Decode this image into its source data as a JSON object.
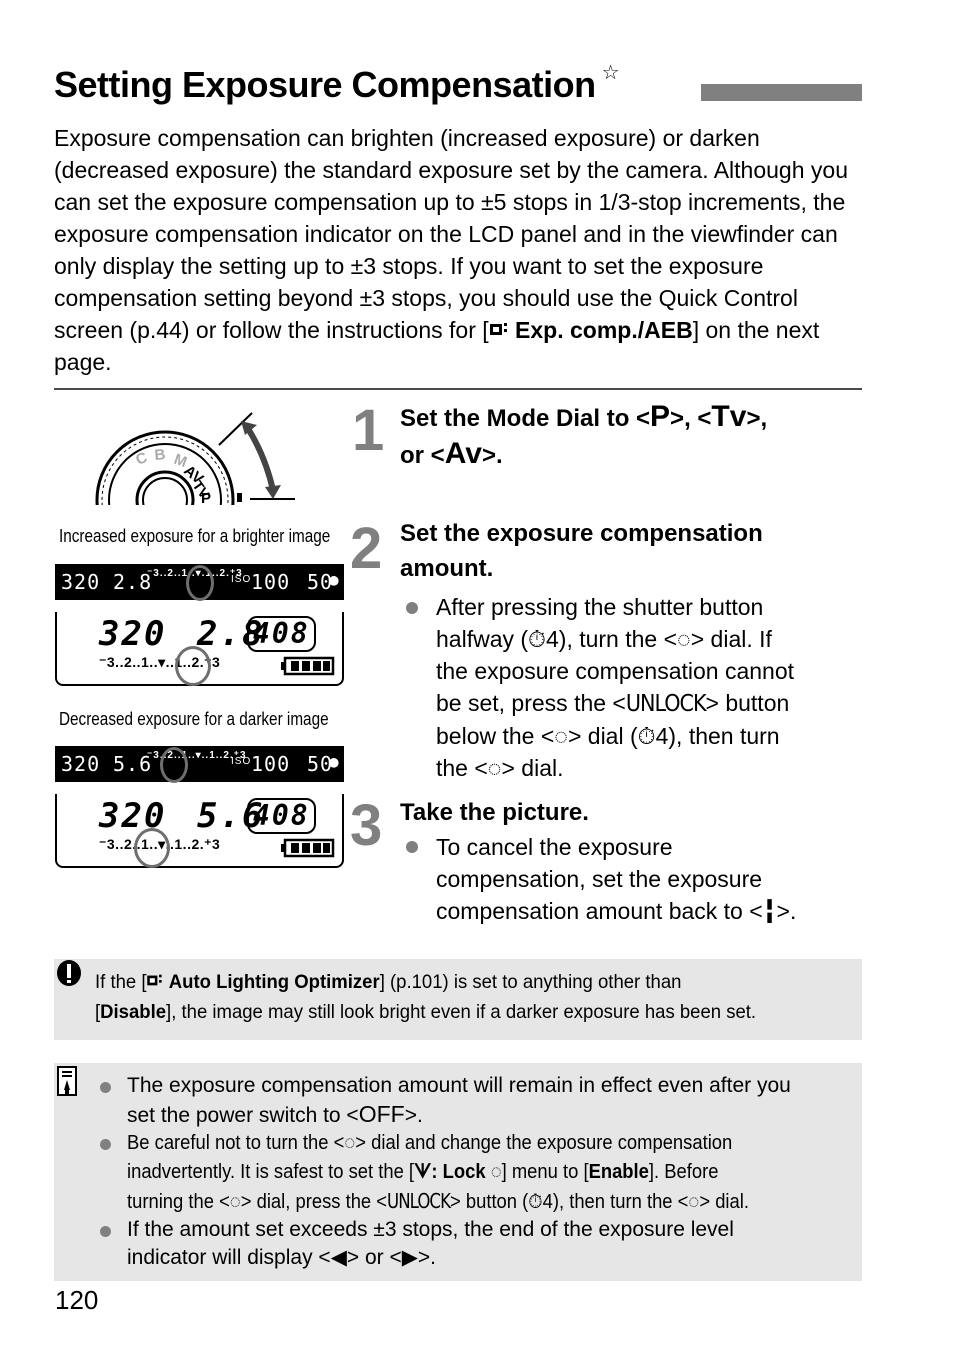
{
  "header": {
    "title": "Setting Exposure Compensation",
    "title_mark": "☆"
  },
  "intro": {
    "text_before": "Exposure compensation can brighten (increased exposure) or darken (decreased exposure) the standard exposure set by the camera. Although you can set the exposure compensation up to ±5 stops in 1/3-stop increments, the exposure compensation indicator on the LCD panel and in the viewfinder can only display the setting up to ±3 stops. If you want to set the exposure compensation setting beyond ±3 stops, you should use the Quick Control screen (p.44) or follow the instructions for [",
    "menu_icon": "camera-menu-icon",
    "menu_label": "Exp. comp./AEB",
    "text_after": "] on the next page."
  },
  "figures": {
    "mode_dial": {
      "labels": [
        "AV",
        "TV",
        "P",
        "M",
        "B",
        "C"
      ]
    },
    "increased": {
      "caption": "Increased exposure for a brighter image",
      "viewfinder": {
        "shutter": "320",
        "aperture": "2.8",
        "scale": "⁻3..2..1..▾.1..2.⁺3",
        "iso_label": "ISO",
        "iso": "100",
        "shots": "50"
      },
      "lcd": {
        "shutter": "320",
        "aperture": "2.8",
        "shots": "408",
        "scale": "⁻3..2..1..▾..1..2.⁺3",
        "compensation_stops": 1
      }
    },
    "decreased": {
      "caption": "Decreased exposure for a darker image",
      "viewfinder": {
        "shutter": "320",
        "aperture": "5.6",
        "scale": "⁻3..2..1..▾..1..2.⁺3",
        "iso_label": "ISO",
        "iso": "100",
        "shots": "50"
      },
      "lcd": {
        "shutter": "320",
        "aperture": "5.6",
        "shots": "408",
        "scale": "⁻3..2..1..▾..1..2.⁺3",
        "compensation_stops": -1
      }
    }
  },
  "steps": [
    {
      "number": "1",
      "title_parts": [
        "Set the Mode Dial to <",
        "P",
        ">, <",
        "Tv",
        ">,",
        "or <",
        "Av",
        ">."
      ]
    },
    {
      "number": "2",
      "title": "Set the exposure compensation amount.",
      "bullet": {
        "line1": "After pressing the shutter button",
        "line2a": "halfway (",
        "timer": "⏱4",
        "line2b": "), turn the <",
        "line2c": "> dial. If",
        "line3": "the exposure compensation cannot",
        "line4a": "be set, press the <",
        "unlock": "UNLOCK",
        "line4b": "> button",
        "line5a": "below the <",
        "line5b": "> dial (",
        "line5c": "), then turn",
        "line6a": "the <",
        "line6b": "> dial."
      }
    },
    {
      "number": "3",
      "title": "Take the picture.",
      "bullet": {
        "line1": "To cancel the exposure",
        "line2": "compensation, set the exposure",
        "line3a": "compensation amount back to <",
        "line3b": ">."
      }
    }
  ],
  "caution": {
    "icon": "caution-icon",
    "line1a": "If the [",
    "menu_label": "Auto Lighting Optimizer",
    "line1b": "] (p.101) is set to anything other than",
    "line2a": "[",
    "disable": "Disable",
    "line2b": "], the image may still look bright even if a darker exposure has been set."
  },
  "notes": {
    "icon": "memo-icon",
    "items": [
      {
        "line1": "The exposure compensation amount will remain in effect even after you",
        "line2a": "set the power switch to <",
        "off": "OFF",
        "line2b": ">."
      },
      {
        "line1a": "Be careful not to turn the <",
        "line1b": "> dial and change the exposure compensation",
        "line2a": "inadvertently. It is safest to set the [",
        "lock": "Lock",
        "line2b": "] menu to [",
        "enable": "Enable",
        "line2c": "]. Before",
        "line3a": "turning the <",
        "line3b": "> dial, press the <",
        "unlock": "UNLOCK",
        "line3c": "> button (",
        "timer": "⏱4",
        "line3d": "), then turn the <",
        "line3e": "> dial."
      },
      {
        "line1": "If the amount set exceeds ±3 stops, the end of the exposure level",
        "line2a": "indicator will display <",
        "line2b": "> or <",
        "line2c": ">."
      }
    ]
  },
  "footer": {
    "page_number": "120"
  }
}
